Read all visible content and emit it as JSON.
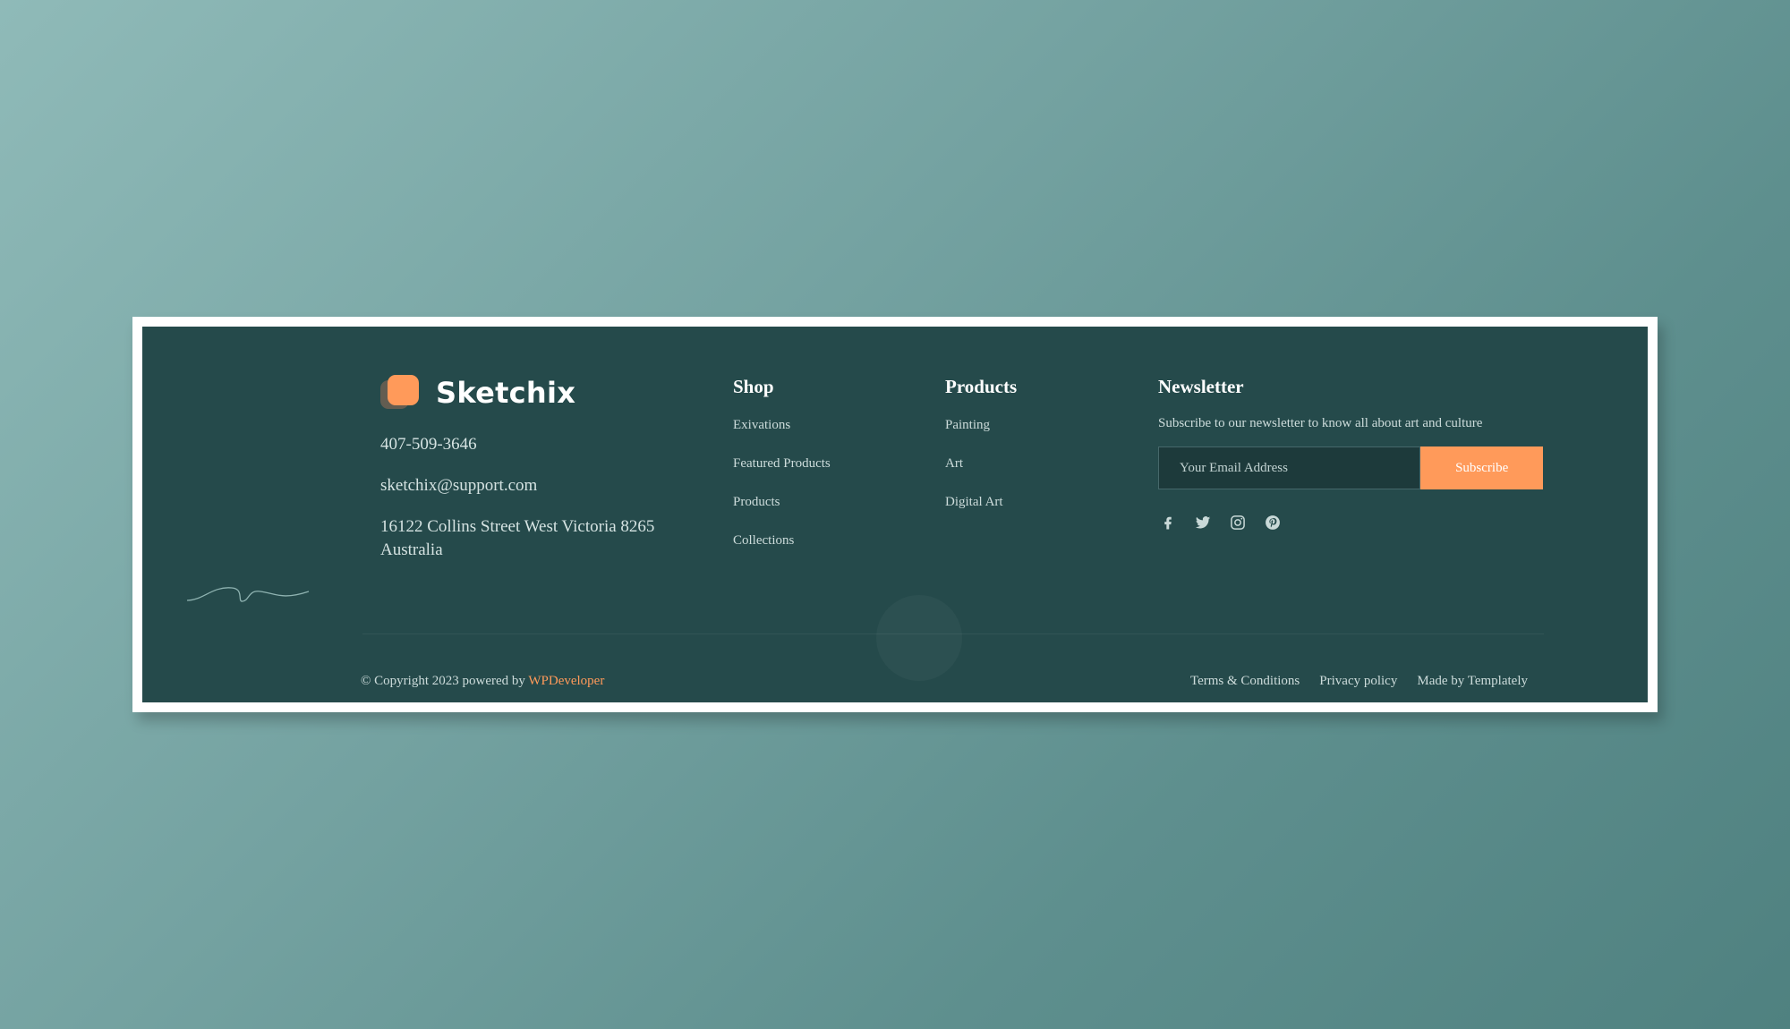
{
  "brand": {
    "name": "Sketchix",
    "accent_color": "#ff9a5a",
    "background_color": "#254a4b"
  },
  "contact": {
    "phone": "407-509-3646",
    "email": "sketchix@support.com",
    "address": "16122 Collins Street West Victoria 8265 Australia"
  },
  "shop": {
    "title": "Shop",
    "links": [
      "Exivations",
      "Featured Products",
      "Products",
      "Collections"
    ]
  },
  "products": {
    "title": "Products",
    "links": [
      "Painting",
      "Art",
      "Digital Art"
    ]
  },
  "newsletter": {
    "title": "Newsletter",
    "description": "Subscribe to our newsletter to know all about art and culture",
    "email_placeholder": "Your Email Address",
    "email_value": "",
    "button_label": "Subscribe"
  },
  "socials": [
    "facebook-icon",
    "twitter-icon",
    "instagram-icon",
    "pinterest-icon"
  ],
  "bottom": {
    "copyright_prefix": "© Copyright 2023 powered by ",
    "copyright_link": "WPDeveloper",
    "legal_links": [
      "Terms & Conditions",
      "Privacy policy",
      "Made by Templately"
    ]
  }
}
